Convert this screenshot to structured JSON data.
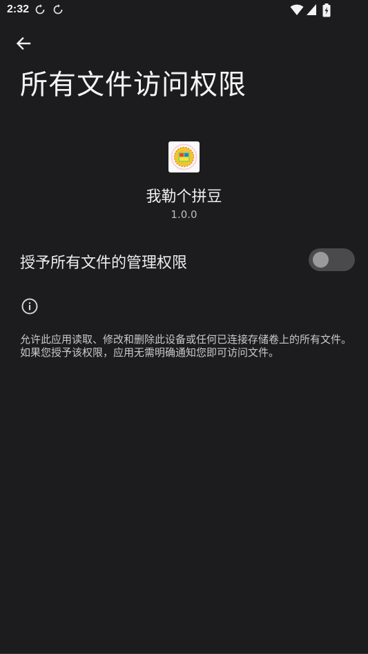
{
  "status_bar": {
    "time": "2:32",
    "sync_icons": [
      "sync-icon",
      "sync-icon"
    ],
    "right_icons": [
      "wifi-icon",
      "signal-icon",
      "battery-charging-icon"
    ]
  },
  "header": {
    "back_icon": "arrow-left-icon",
    "title": "所有文件访问权限"
  },
  "app": {
    "name": "我勒个拼豆",
    "version": "1.0.0"
  },
  "permission": {
    "label": "授予所有文件的管理权限",
    "enabled": false
  },
  "info": {
    "icon": "info-icon",
    "description": "允许此应用读取、修改和删除此设备或任何已连接存储卷上的所有文件。如果您授予该权限，应用无需明确通知您即可访问文件。"
  },
  "colors": {
    "background": "#1c1c1e",
    "text": "#ececec",
    "switch_track": "#4a4a4c",
    "switch_knob": "#9a9a9c"
  }
}
